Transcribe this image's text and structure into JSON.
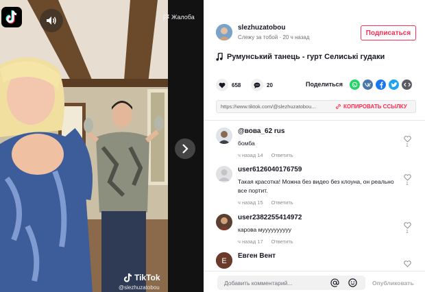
{
  "video": {
    "report_label": "Жалоба",
    "watermark_brand": "TikTok",
    "watermark_user": "@slezhuzatobou"
  },
  "post": {
    "author": "slezhuzatobou",
    "subtitle": "Слежу за тобой · 20 ч назад",
    "follow_label": "Подписаться",
    "music": "Румунський танець - гурт Селиські гудаки",
    "likes": "658",
    "comments_count": "20",
    "share_label": "Поделиться",
    "share_icons": [
      "whatsapp-icon",
      "vk-icon",
      "facebook-icon",
      "twitter-icon",
      "embed-icon"
    ],
    "link": "https://www.tiktok.com/@slezhuzatobou...",
    "copy_link_label": "КОПИРОВАТЬ ССЫЛКУ"
  },
  "comments": [
    {
      "user": "@вова_62 rus",
      "text": "бомба",
      "time": "ч назад 14",
      "reply": "Ответить",
      "likes": "1"
    },
    {
      "user": "user6126040176759",
      "text": "Такая красотка! Можна без видео без клоуна, он реально все портит.",
      "time": "ч назад 15",
      "reply": "Ответить",
      "likes": "1"
    },
    {
      "user": "user2382255414972",
      "text": "карова муууууууууу",
      "time": "ч назад 17",
      "reply": "Ответить",
      "likes": "1"
    },
    {
      "user": "Евген Вент",
      "text": "",
      "time": "",
      "reply": "",
      "likes": ""
    }
  ],
  "composer": {
    "placeholder": "Добавить комментарий...",
    "publish_label": "Опубликовать"
  },
  "colors": {
    "accent": "#fe2c55",
    "whatsapp": "#25d366",
    "vk": "#4a76a8",
    "facebook": "#1877f2",
    "twitter": "#1da1f2",
    "embed": "#5b5b63"
  }
}
